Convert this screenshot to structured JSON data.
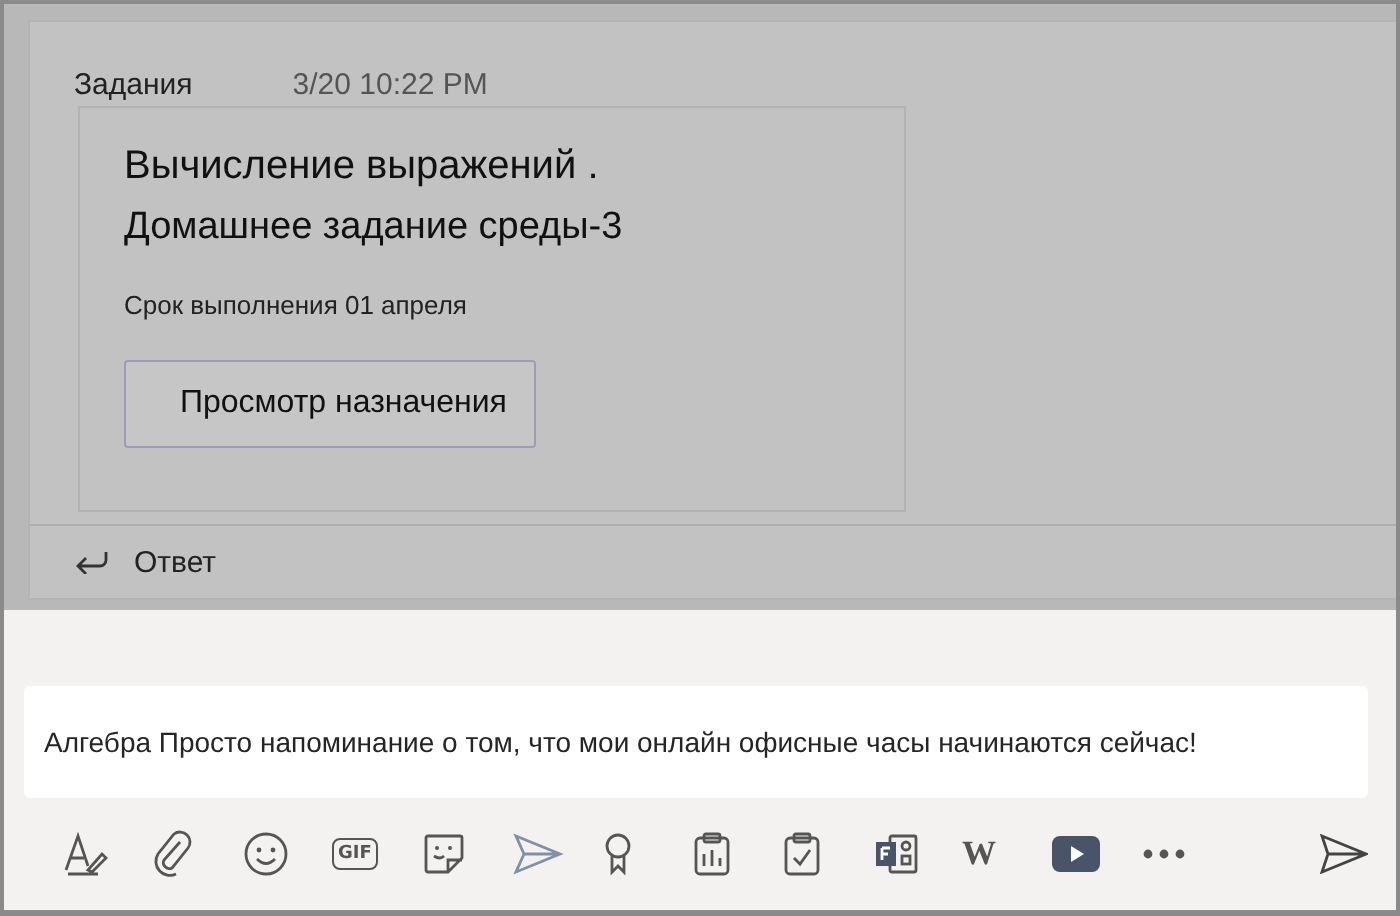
{
  "post": {
    "channel": "Задания",
    "time": "3/20 10:22 PM",
    "card": {
      "title": "Вычисление выражений .",
      "subtitle": "Домашнее задание среды-3",
      "due": "Срок выполнения 01 апреля",
      "button": "Просмотр назначения"
    },
    "reply": "Ответ"
  },
  "compose": {
    "message": "Алгебра Просто напоминание о том, что мои онлайн офисные часы начинаются сейчас!",
    "toolbar": [
      {
        "kind": "format"
      },
      {
        "kind": "attach"
      },
      {
        "kind": "emoji"
      },
      {
        "kind": "gif",
        "label": "GIF"
      },
      {
        "kind": "sticker"
      },
      {
        "kind": "praise-send"
      },
      {
        "kind": "award"
      },
      {
        "kind": "insights"
      },
      {
        "kind": "assignment"
      },
      {
        "kind": "forms"
      },
      {
        "kind": "wiki",
        "label": "W"
      },
      {
        "kind": "video"
      },
      {
        "kind": "more"
      }
    ]
  }
}
